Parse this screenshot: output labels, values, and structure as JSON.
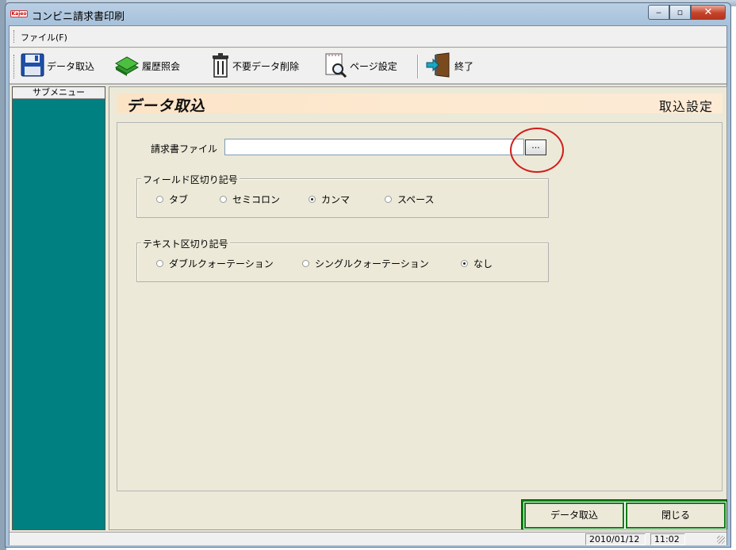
{
  "window": {
    "title": "コンビニ請求書印刷",
    "app_logo_text": "Kajeo"
  },
  "caption_buttons": {
    "minimize": "‒",
    "maximize": "▫",
    "close": "✕"
  },
  "menu": {
    "file_label": "ファイル(F)"
  },
  "toolbar": {
    "import_label": "データ取込",
    "history_label": "履歴照会",
    "delete_label": "不要データ削除",
    "page_setup_label": "ページ設定",
    "exit_label": "終了"
  },
  "sidebar": {
    "header": "サブメニュー"
  },
  "header": {
    "title": "データ取込",
    "right": "取込設定"
  },
  "form": {
    "file_label": "請求書ファイル",
    "file_value": "",
    "browse_label": "..."
  },
  "field_separator": {
    "title": "フィールド区切り記号",
    "options": [
      {
        "label": "タブ",
        "selected": false
      },
      {
        "label": "セミコロン",
        "selected": false
      },
      {
        "label": "カンマ",
        "selected": true
      },
      {
        "label": "スペース",
        "selected": false
      }
    ]
  },
  "text_separator": {
    "title": "テキスト区切り記号",
    "options": [
      {
        "label": "ダブルクォーテーション",
        "selected": false
      },
      {
        "label": "シングルクォーテーション",
        "selected": false
      },
      {
        "label": "なし",
        "selected": true
      }
    ]
  },
  "actions": {
    "import_label": "データ取込",
    "close_label": "閉じる"
  },
  "status": {
    "date": "2010/01/12",
    "time": "11:02"
  },
  "colors": {
    "sidebar": "#008080",
    "header_band": "#fde8cf",
    "action_bar": "#0a7d16",
    "highlight": "#d31c1c"
  }
}
